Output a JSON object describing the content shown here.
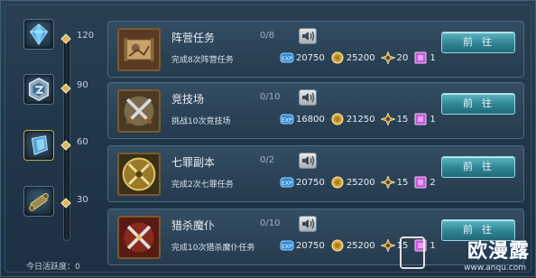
{
  "track": {
    "marks": [
      {
        "value": "120"
      },
      {
        "value": "90"
      },
      {
        "value": "60"
      },
      {
        "value": "30"
      }
    ],
    "rewards": [
      {
        "icon": "blue-crystal-icon"
      },
      {
        "icon": "hexagon-token-icon"
      },
      {
        "icon": "ice-shard-icon"
      },
      {
        "icon": "scroll-icon"
      }
    ],
    "activity_label": "今日活跃度：",
    "activity_value": "0"
  },
  "tasks": [
    {
      "name": "阵营任务",
      "progress": "0/8",
      "desc": "完成8次阵营任务",
      "exp": "20750",
      "coins": "25200",
      "tokens": "20",
      "gems": "1",
      "button": "前往",
      "icon": "map-scroll-icon"
    },
    {
      "name": "竞技场",
      "progress": "0/10",
      "desc": "挑战10次竞技场",
      "exp": "16800",
      "coins": "21250",
      "tokens": "15",
      "gems": "1",
      "button": "前往",
      "icon": "crossed-swords-icon"
    },
    {
      "name": "七罪副本",
      "progress": "0/2",
      "desc": "完成2次七罪任务",
      "exp": "20750",
      "coins": "25200",
      "tokens": "15",
      "gems": "2",
      "button": "前往",
      "icon": "golden-swords-icon"
    },
    {
      "name": "猎杀魔仆",
      "progress": "0/10",
      "desc": "完成10次猎杀魔仆任务",
      "exp": "20750",
      "coins": "25200",
      "tokens": "15",
      "gems": "1",
      "button": "前往",
      "icon": "red-swords-icon"
    }
  ],
  "watermark": {
    "main": "欧漫露",
    "url": "www.anqu.com"
  },
  "colors": {
    "accent": "#2f8393",
    "panel": "#2b4256",
    "border": "#4a6a84"
  }
}
